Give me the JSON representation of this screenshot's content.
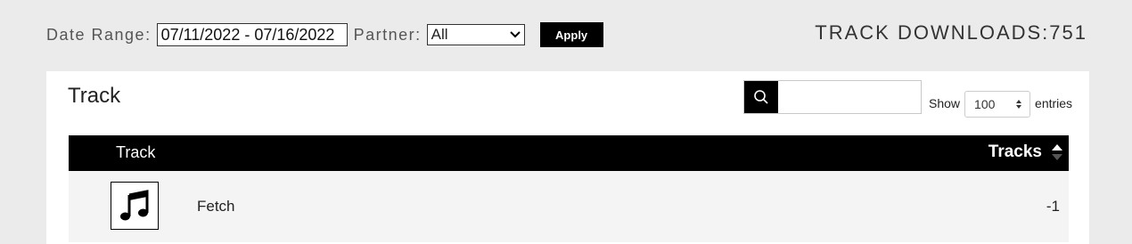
{
  "filters": {
    "date_range_label": "Date Range:",
    "date_range_value": "07/11/2022 - 07/16/2022",
    "partner_label": "Partner:",
    "partner_value": "All",
    "apply_label": "Apply"
  },
  "downloads_text": "TRACK DOWNLOADS:751",
  "card": {
    "title": "Track",
    "search_value": "",
    "show_label": "Show",
    "entries_value": "100",
    "entries_label": "entries"
  },
  "table": {
    "columns": [
      "Track",
      "Tracks"
    ],
    "rows": [
      {
        "name": "Fetch",
        "tracks": "-1",
        "icon": "music-note-icon"
      }
    ]
  },
  "colors": {
    "page_bg": "#ebebeb",
    "header_bg": "#000000",
    "row_bg": "#f4f4f4"
  }
}
